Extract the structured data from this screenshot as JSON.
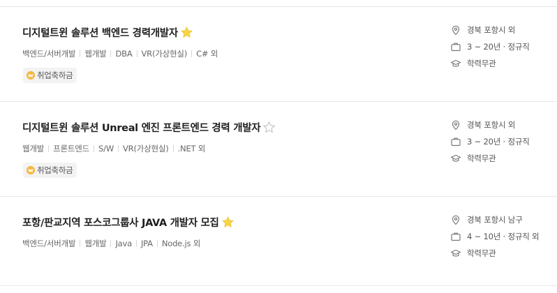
{
  "jobs": [
    {
      "title": "디지털트윈 솔루션 백엔드 경력개발자",
      "starred": true,
      "tags": [
        "백엔드/서버개발",
        "웹개발",
        "DBA",
        "VR(가상현실)",
        "C# 외"
      ],
      "badge": "취업축하금",
      "location": "경북 포항시 외",
      "career": "3 ~ 20년 · 정규직",
      "education": "학력무관"
    },
    {
      "title": "디지털트윈 솔루션 Unreal 엔진 프론트엔드 경력 개발자",
      "starred": false,
      "tags": [
        "웹개발",
        "프론트엔드",
        "S/W",
        "VR(가상현실)",
        ".NET 외"
      ],
      "badge": "취업축하금",
      "location": "경북 포항시 외",
      "career": "3 ~ 20년 · 정규직",
      "education": "학력무관"
    },
    {
      "title": "포항/판교지역 포스코그룹사 JAVA 개발자 모집",
      "starred": true,
      "tags": [
        "백엔드/서버개발",
        "웹개발",
        "Java",
        "JPA",
        "Node.js 외"
      ],
      "badge": "",
      "location": "경북 포항시 남구",
      "career": "4 ~ 10년 · 정규직 외",
      "education": "학력무관"
    }
  ],
  "icons": {
    "star_filled_color": "#f7d443",
    "star_empty_color": "#bdbdbd",
    "badge_icon_color": "#f6b73c",
    "location": "location-pin-icon",
    "career": "briefcase-icon",
    "education": "graduation-cap-icon",
    "badge": "coin-icon",
    "star": "star-icon"
  }
}
